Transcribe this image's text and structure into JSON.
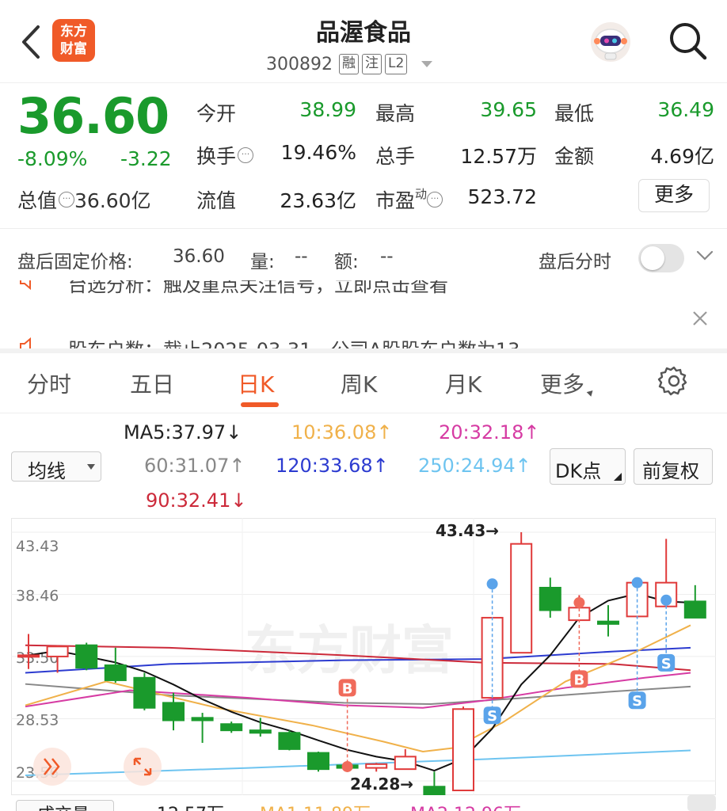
{
  "header": {
    "logo_text_line1": "东方",
    "logo_text_line2": "财富",
    "title": "品渥食品",
    "code": "300892",
    "tags": [
      "融",
      "注",
      "L2"
    ]
  },
  "quote": {
    "price": "36.60",
    "pct": "-8.09%",
    "change": "-3.22",
    "fields": {
      "open_label": "今开",
      "open_value": "38.99",
      "high_label": "最高",
      "high_value": "39.65",
      "low_label": "最低",
      "low_value": "36.49",
      "turnover_label": "换手",
      "turnover_value": "19.46%",
      "volume_label": "总手",
      "volume_value": "12.57万",
      "amount_label": "金额",
      "amount_value": "4.69亿",
      "mktcap_label": "总值",
      "mktcap_value": "36.60亿",
      "float_label": "流值",
      "float_value": "23.63亿",
      "pe_label": "市盈",
      "pe_sup": "动",
      "pe_value": "523.72"
    },
    "more_button": "更多"
  },
  "after_hours": {
    "label": "盘后固定价格:",
    "price": "36.60",
    "vol_label": "量:",
    "vol_value": "--",
    "amt_label": "额:",
    "amt_value": "--",
    "timeshare_label": "盘后分时"
  },
  "news": [
    "台选分析：触及重点关注信号，立即点击查看",
    "股东户数：截止2025-03-31，公司A股股东户数为13"
  ],
  "tabs": [
    "分时",
    "五日",
    "日K",
    "周K",
    "月K",
    "更多"
  ],
  "ma": {
    "selector": "均线",
    "ma5": "MA5:37.97",
    "ma10": "10:36.08",
    "ma20": "20:32.18",
    "ma60": "60:31.07",
    "ma120": "120:33.68",
    "ma250": "250:24.94",
    "ma90": "90:32.41",
    "dk_button": "DK点",
    "adjust_button": "前复权",
    "down_arrow": "↓",
    "up_arrow": "↑"
  },
  "chart_data": {
    "type": "candlestick",
    "y_ticks": [
      "43.43",
      "38.46",
      "33.50",
      "28.53",
      "23.56"
    ],
    "high_annotation": "43.43→",
    "low_annotation": "24.28→",
    "ylim": [
      23.56,
      43.43
    ],
    "watermark": "东方财富",
    "candles": [
      {
        "o": 33.6,
        "c": 33.6,
        "h": 35.3,
        "l": 32.5
      },
      {
        "o": 33.5,
        "c": 34.3,
        "h": 34.4,
        "l": 32.2
      },
      {
        "o": 34.4,
        "c": 32.6,
        "h": 34.6,
        "l": 32.4
      },
      {
        "o": 32.8,
        "c": 31.6,
        "h": 34.2,
        "l": 31.4
      },
      {
        "o": 31.8,
        "c": 29.4,
        "h": 32.2,
        "l": 29.2
      },
      {
        "o": 29.8,
        "c": 28.4,
        "h": 30.6,
        "l": 27.6
      },
      {
        "o": 28.6,
        "c": 28.4,
        "h": 29.0,
        "l": 26.6
      },
      {
        "o": 28.1,
        "c": 27.6,
        "h": 28.3,
        "l": 27.4
      },
      {
        "o": 27.6,
        "c": 27.4,
        "h": 28.6,
        "l": 27.1
      },
      {
        "o": 27.4,
        "c": 26.1,
        "h": 27.6,
        "l": 26.0
      },
      {
        "o": 25.8,
        "c": 24.5,
        "h": 25.9,
        "l": 24.3
      },
      {
        "o": 24.8,
        "c": 24.6,
        "h": 25.1,
        "l": 24.4
      },
      {
        "o": 24.6,
        "c": 24.9,
        "h": 25.0,
        "l": 24.3
      },
      {
        "o": 24.5,
        "c": 25.5,
        "h": 26.1,
        "l": 24.5
      },
      {
        "o": 23.1,
        "c": 22.4,
        "h": 24.3,
        "l": 21.2
      },
      {
        "o": 22.8,
        "c": 29.3,
        "h": 29.5,
        "l": 22.8
      },
      {
        "o": 30.2,
        "c": 36.6,
        "h": 36.6,
        "l": 30.2
      },
      {
        "o": 33.8,
        "c": 42.5,
        "h": 43.43,
        "l": 33.8
      },
      {
        "o": 39.0,
        "c": 37.2,
        "h": 39.8,
        "l": 36.6
      },
      {
        "o": 36.4,
        "c": 37.4,
        "h": 38.4,
        "l": 36.4
      },
      {
        "o": 36.3,
        "c": 36.1,
        "h": 37.6,
        "l": 35.1
      },
      {
        "o": 36.7,
        "c": 39.4,
        "h": 39.8,
        "l": 36.6
      },
      {
        "o": 37.5,
        "c": 39.4,
        "h": 42.9,
        "l": 37.5
      },
      {
        "o": 37.9,
        "c": 36.6,
        "h": 39.2,
        "l": 36.6
      }
    ],
    "markers": [
      {
        "i": 11,
        "type": "B",
        "dot_y": 24.7,
        "label_y": 31.0,
        "color": "#f06b5b"
      },
      {
        "i": 16,
        "type": "S",
        "dot_y": 39.3,
        "label_y": 28.8,
        "color": "#5aa3ea"
      },
      {
        "i": 19,
        "type": "B",
        "dot_y": 37.8,
        "label_y": 31.7,
        "color": "#f06b5b"
      },
      {
        "i": 21,
        "type": "S",
        "dot_y": 39.4,
        "label_y": 30.0,
        "color": "#5aa3ea"
      },
      {
        "i": 22,
        "type": "S",
        "dot_y": 38.0,
        "label_y": 33.0,
        "color": "#5aa3ea"
      }
    ]
  },
  "volume_bar": {
    "label": "成交量",
    "vol": "12.57万",
    "ma1": "MA1 11.89万",
    "ma2": "MA2 12.96万"
  }
}
